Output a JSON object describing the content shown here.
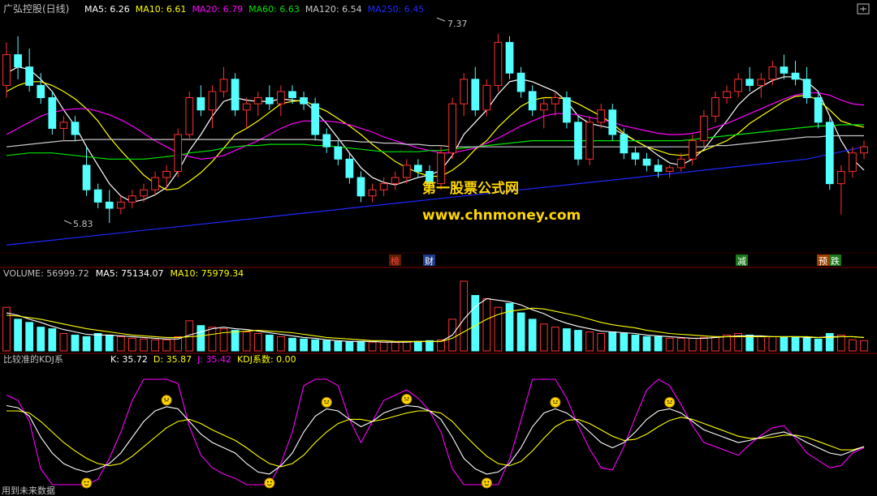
{
  "colors": {
    "up": "#ff3232",
    "down": "#54ffff",
    "ma5": "#ffffff",
    "ma10": "#ffff00",
    "ma20": "#ff00ff",
    "ma60": "#00e600",
    "ma120": "#c8c8c8",
    "ma250": "#1e28ff",
    "label": "#c0c0c0",
    "frame": "#800000",
    "watermark": "#ffd700"
  },
  "price_panel": {
    "title": "广弘控股(日线)",
    "legend": [
      {
        "label": "MA5: 6.26",
        "color": "#ffffff"
      },
      {
        "label": "MA10: 6.61",
        "color": "#ffff00"
      },
      {
        "label": "MA20: 6.79",
        "color": "#ff00ff"
      },
      {
        "label": "MA60: 6.63",
        "color": "#00e600"
      },
      {
        "label": "MA120: 6.54",
        "color": "#c8c8c8"
      },
      {
        "label": "MA250: 6.45",
        "color": "#1e28ff"
      }
    ],
    "high_label": "7.37",
    "low_label": "5.83",
    "markers": [
      {
        "text": "榜",
        "color": "#ff4040",
        "bg": "#5a2000"
      },
      {
        "text": "财",
        "color": "#ffffff",
        "bg": "#1e3a8a"
      },
      {
        "text": "减",
        "color": "#ffffff",
        "bg": "#1a7a1a"
      },
      {
        "text": "预",
        "color": "#ffffff",
        "bg": "#a04000"
      },
      {
        "text": "跌",
        "color": "#ffffff",
        "bg": "#1a7a1a"
      }
    ]
  },
  "watermark": {
    "line1": "第一股票公式网",
    "line2": "www.chnmoney.com"
  },
  "volume_panel": {
    "legend": [
      {
        "label": "VOLUME: 56999.72",
        "color": "#c0c0c0"
      },
      {
        "label": "MA5: 75134.07",
        "color": "#ffffff"
      },
      {
        "label": "MA10: 75979.34",
        "color": "#ffff00"
      }
    ]
  },
  "kdj_panel": {
    "title": "比较准的KDJ系",
    "legend": [
      {
        "label": "K: 35.72",
        "color": "#ffffff"
      },
      {
        "label": "D: 35.87",
        "color": "#ffff00"
      },
      {
        "label": "J: 35.42",
        "color": "#ff00ff"
      },
      {
        "label": "KDJ系数: 0.00",
        "color": "#ffff00"
      }
    ]
  },
  "footer_text": "用到未来数据",
  "chart_data": {
    "type": "candlestick",
    "ylim": [
      5.6,
      7.5
    ],
    "ohlc": [
      [
        6.95,
        7.3,
        6.85,
        7.2
      ],
      [
        7.2,
        7.35,
        7.0,
        7.1
      ],
      [
        7.1,
        7.25,
        6.9,
        6.95
      ],
      [
        6.95,
        7.05,
        6.8,
        6.85
      ],
      [
        6.85,
        6.9,
        6.55,
        6.6
      ],
      [
        6.6,
        6.7,
        6.5,
        6.65
      ],
      [
        6.65,
        6.7,
        6.5,
        6.55
      ],
      [
        6.3,
        6.45,
        6.05,
        6.1
      ],
      [
        6.1,
        6.15,
        5.95,
        6.0
      ],
      [
        6.0,
        6.1,
        5.83,
        5.95
      ],
      [
        5.95,
        6.05,
        5.9,
        6.0
      ],
      [
        6.0,
        6.1,
        5.95,
        6.05
      ],
      [
        6.05,
        6.15,
        6.0,
        6.1
      ],
      [
        6.1,
        6.25,
        6.05,
        6.2
      ],
      [
        6.2,
        6.3,
        6.1,
        6.25
      ],
      [
        6.25,
        6.6,
        6.2,
        6.55
      ],
      [
        6.55,
        6.9,
        6.5,
        6.85
      ],
      [
        6.85,
        6.95,
        6.7,
        6.75
      ],
      [
        6.75,
        6.95,
        6.6,
        6.9
      ],
      [
        6.9,
        7.1,
        6.85,
        7.0
      ],
      [
        7.0,
        7.05,
        6.7,
        6.75
      ],
      [
        6.75,
        6.85,
        6.6,
        6.8
      ],
      [
        6.8,
        6.9,
        6.7,
        6.85
      ],
      [
        6.85,
        6.95,
        6.75,
        6.8
      ],
      [
        6.8,
        6.95,
        6.7,
        6.9
      ],
      [
        6.9,
        6.95,
        6.8,
        6.85
      ],
      [
        6.85,
        6.9,
        6.75,
        6.8
      ],
      [
        6.8,
        6.85,
        6.5,
        6.55
      ],
      [
        6.55,
        6.6,
        6.4,
        6.45
      ],
      [
        6.45,
        6.5,
        6.3,
        6.35
      ],
      [
        6.35,
        6.4,
        6.15,
        6.2
      ],
      [
        6.2,
        6.25,
        6.0,
        6.05
      ],
      [
        6.05,
        6.15,
        6.0,
        6.1
      ],
      [
        6.1,
        6.2,
        6.05,
        6.15
      ],
      [
        6.15,
        6.25,
        6.1,
        6.2
      ],
      [
        6.2,
        6.35,
        6.15,
        6.3
      ],
      [
        6.3,
        6.35,
        6.2,
        6.25
      ],
      [
        6.25,
        6.3,
        6.1,
        6.15
      ],
      [
        6.15,
        6.45,
        6.1,
        6.4
      ],
      [
        6.4,
        6.85,
        6.35,
        6.8
      ],
      [
        6.8,
        7.05,
        6.7,
        7.0
      ],
      [
        7.0,
        7.1,
        6.7,
        6.75
      ],
      [
        6.75,
        7.0,
        6.7,
        6.95
      ],
      [
        6.95,
        7.37,
        6.9,
        7.3
      ],
      [
        7.3,
        7.35,
        7.0,
        7.05
      ],
      [
        7.05,
        7.1,
        6.85,
        6.9
      ],
      [
        6.9,
        6.95,
        6.7,
        6.75
      ],
      [
        6.75,
        6.85,
        6.6,
        6.8
      ],
      [
        6.8,
        6.9,
        6.7,
        6.85
      ],
      [
        6.85,
        6.9,
        6.6,
        6.65
      ],
      [
        6.65,
        6.7,
        6.3,
        6.35
      ],
      [
        6.35,
        6.7,
        6.3,
        6.65
      ],
      [
        6.65,
        6.8,
        6.6,
        6.75
      ],
      [
        6.75,
        6.8,
        6.5,
        6.55
      ],
      [
        6.55,
        6.6,
        6.35,
        6.4
      ],
      [
        6.4,
        6.45,
        6.3,
        6.35
      ],
      [
        6.35,
        6.4,
        6.25,
        6.3
      ],
      [
        6.3,
        6.35,
        6.2,
        6.25
      ],
      [
        6.25,
        6.3,
        6.2,
        6.28
      ],
      [
        6.28,
        6.4,
        6.25,
        6.35
      ],
      [
        6.35,
        6.55,
        6.3,
        6.5
      ],
      [
        6.5,
        6.75,
        6.45,
        6.7
      ],
      [
        6.7,
        6.9,
        6.65,
        6.85
      ],
      [
        6.85,
        6.95,
        6.8,
        6.9
      ],
      [
        6.9,
        7.05,
        6.85,
        7.0
      ],
      [
        7.0,
        7.1,
        6.9,
        6.95
      ],
      [
        6.95,
        7.05,
        6.85,
        7.0
      ],
      [
        7.0,
        7.15,
        6.95,
        7.1
      ],
      [
        7.1,
        7.2,
        7.0,
        7.05
      ],
      [
        7.05,
        7.15,
        6.95,
        7.0
      ],
      [
        7.0,
        7.1,
        6.8,
        6.85
      ],
      [
        6.85,
        6.9,
        6.6,
        6.65
      ],
      [
        6.65,
        6.7,
        6.1,
        6.15
      ],
      [
        6.15,
        6.3,
        5.9,
        6.25
      ],
      [
        6.25,
        6.45,
        6.2,
        6.4
      ],
      [
        6.4,
        6.5,
        6.35,
        6.45
      ]
    ],
    "ma": {
      "MA5": [
        7.05,
        7.1,
        7.08,
        7.0,
        6.9,
        6.75,
        6.62,
        6.45,
        6.3,
        6.15,
        6.05,
        6.0,
        6.02,
        6.06,
        6.12,
        6.25,
        6.42,
        6.55,
        6.7,
        6.82,
        6.85,
        6.83,
        6.82,
        6.82,
        6.84,
        6.83,
        6.82,
        6.74,
        6.64,
        6.52,
        6.4,
        6.28,
        6.2,
        6.16,
        6.14,
        6.17,
        6.2,
        6.22,
        6.26,
        6.38,
        6.55,
        6.65,
        6.75,
        6.88,
        6.98,
        7.0,
        6.98,
        6.94,
        6.9,
        6.82,
        6.7,
        6.64,
        6.62,
        6.6,
        6.55,
        6.5,
        6.45,
        6.38,
        6.32,
        6.3,
        6.35,
        6.43,
        6.55,
        6.66,
        6.79,
        6.88,
        6.94,
        6.99,
        7.02,
        7.02,
        6.98,
        6.9,
        6.7,
        6.5,
        6.35,
        6.26
      ],
      "MA10": [
        6.9,
        6.95,
        6.98,
        6.98,
        6.95,
        6.9,
        6.84,
        6.76,
        6.66,
        6.53,
        6.42,
        6.32,
        6.22,
        6.15,
        6.1,
        6.11,
        6.17,
        6.24,
        6.33,
        6.44,
        6.55,
        6.6,
        6.66,
        6.73,
        6.8,
        6.82,
        6.83,
        6.78,
        6.74,
        6.68,
        6.62,
        6.55,
        6.47,
        6.4,
        6.33,
        6.28,
        6.24,
        6.21,
        6.21,
        6.26,
        6.33,
        6.43,
        6.5,
        6.61,
        6.7,
        6.78,
        6.83,
        6.85,
        6.85,
        6.84,
        6.8,
        6.75,
        6.7,
        6.64,
        6.56,
        6.5,
        6.45,
        6.42,
        6.39,
        6.38,
        6.39,
        6.42,
        6.46,
        6.5,
        6.56,
        6.64,
        6.7,
        6.76,
        6.82,
        6.86,
        6.87,
        6.83,
        6.75,
        6.66,
        6.63,
        6.61
      ],
      "MA20": [
        6.55,
        6.6,
        6.65,
        6.7,
        6.73,
        6.75,
        6.76,
        6.76,
        6.74,
        6.71,
        6.67,
        6.62,
        6.56,
        6.5,
        6.45,
        6.4,
        6.37,
        6.35,
        6.36,
        6.38,
        6.42,
        6.46,
        6.5,
        6.55,
        6.6,
        6.64,
        6.66,
        6.66,
        6.66,
        6.65,
        6.63,
        6.6,
        6.57,
        6.53,
        6.5,
        6.47,
        6.44,
        6.42,
        6.4,
        6.4,
        6.42,
        6.44,
        6.48,
        6.52,
        6.57,
        6.62,
        6.66,
        6.7,
        6.72,
        6.72,
        6.71,
        6.69,
        6.67,
        6.65,
        6.62,
        6.6,
        6.58,
        6.56,
        6.55,
        6.55,
        6.56,
        6.58,
        6.61,
        6.64,
        6.68,
        6.72,
        6.76,
        6.8,
        6.84,
        6.87,
        6.89,
        6.89,
        6.87,
        6.83,
        6.8,
        6.79
      ],
      "MA60": [
        6.38,
        6.39,
        6.4,
        6.4,
        6.4,
        6.39,
        6.38,
        6.37,
        6.36,
        6.35,
        6.35,
        6.35,
        6.35,
        6.36,
        6.37,
        6.38,
        6.4,
        6.41,
        6.42,
        6.44,
        6.45,
        6.46,
        6.46,
        6.47,
        6.47,
        6.47,
        6.47,
        6.46,
        6.46,
        6.45,
        6.44,
        6.43,
        6.42,
        6.41,
        6.41,
        6.41,
        6.41,
        6.42,
        6.42,
        6.43,
        6.44,
        6.45,
        6.46,
        6.47,
        6.48,
        6.49,
        6.5,
        6.5,
        6.5,
        6.5,
        6.5,
        6.5,
        6.5,
        6.5,
        6.5,
        6.5,
        6.5,
        6.5,
        6.5,
        6.5,
        6.51,
        6.52,
        6.53,
        6.54,
        6.55,
        6.56,
        6.57,
        6.58,
        6.59,
        6.6,
        6.61,
        6.62,
        6.62,
        6.63,
        6.63,
        6.63
      ],
      "MA120": [
        6.45,
        6.46,
        6.47,
        6.48,
        6.49,
        6.5,
        6.5,
        6.51,
        6.51,
        6.51,
        6.51,
        6.51,
        6.51,
        6.51,
        6.51,
        6.51,
        6.51,
        6.51,
        6.51,
        6.51,
        6.51,
        6.51,
        6.51,
        6.51,
        6.51,
        6.51,
        6.51,
        6.51,
        6.5,
        6.5,
        6.5,
        6.49,
        6.49,
        6.48,
        6.48,
        6.47,
        6.47,
        6.46,
        6.46,
        6.45,
        6.45,
        6.45,
        6.45,
        6.45,
        6.45,
        6.45,
        6.45,
        6.45,
        6.45,
        6.45,
        6.45,
        6.45,
        6.45,
        6.45,
        6.45,
        6.45,
        6.45,
        6.45,
        6.45,
        6.45,
        6.45,
        6.45,
        6.46,
        6.46,
        6.47,
        6.48,
        6.49,
        6.5,
        6.51,
        6.52,
        6.53,
        6.53,
        6.54,
        6.54,
        6.54,
        6.54
      ],
      "MA250": [
        5.65,
        5.66,
        5.67,
        5.68,
        5.69,
        5.7,
        5.71,
        5.72,
        5.73,
        5.74,
        5.75,
        5.76,
        5.77,
        5.78,
        5.79,
        5.8,
        5.81,
        5.82,
        5.83,
        5.84,
        5.85,
        5.86,
        5.87,
        5.88,
        5.89,
        5.9,
        5.91,
        5.92,
        5.93,
        5.94,
        5.95,
        5.96,
        5.97,
        5.98,
        5.99,
        6.0,
        6.01,
        6.02,
        6.03,
        6.04,
        6.05,
        6.06,
        6.07,
        6.08,
        6.09,
        6.1,
        6.11,
        6.12,
        6.13,
        6.14,
        6.15,
        6.16,
        6.17,
        6.18,
        6.19,
        6.2,
        6.21,
        6.22,
        6.23,
        6.24,
        6.25,
        6.26,
        6.27,
        6.28,
        6.29,
        6.3,
        6.31,
        6.32,
        6.33,
        6.34,
        6.35,
        6.37,
        6.39,
        6.41,
        6.43,
        6.45
      ]
    },
    "volume": [
      55,
      40,
      36,
      30,
      28,
      22,
      20,
      18,
      22,
      20,
      18,
      16,
      15,
      14,
      14,
      18,
      38,
      32,
      30,
      28,
      26,
      24,
      22,
      20,
      18,
      16,
      15,
      14,
      13,
      12,
      12,
      12,
      11,
      11,
      11,
      12,
      12,
      13,
      14,
      40,
      88,
      70,
      66,
      55,
      60,
      48,
      40,
      34,
      30,
      28,
      26,
      24,
      22,
      24,
      22,
      20,
      18,
      18,
      16,
      16,
      16,
      17,
      18,
      20,
      22,
      20,
      18,
      18,
      17,
      18,
      16,
      15,
      22,
      20,
      14,
      13
    ],
    "volume_ma5": [
      48,
      45,
      40,
      36,
      31,
      27,
      24,
      21,
      20,
      20,
      19,
      18,
      17,
      16,
      15,
      15,
      20,
      24,
      28,
      30,
      28,
      27,
      25,
      23,
      21,
      19,
      17,
      16,
      14,
      13,
      12,
      12,
      12,
      11,
      11,
      11,
      12,
      12,
      12,
      20,
      40,
      56,
      66,
      64,
      62,
      58,
      52,
      47,
      40,
      35,
      31,
      28,
      25,
      24,
      23,
      22,
      20,
      19,
      18,
      17,
      16,
      16,
      17,
      18,
      19,
      19,
      19,
      18,
      18,
      18,
      17,
      17,
      18,
      18,
      18,
      17
    ],
    "volume_ma10": [
      45,
      44,
      42,
      40,
      37,
      34,
      31,
      28,
      26,
      24,
      22,
      20,
      19,
      18,
      17,
      17,
      18,
      19,
      21,
      23,
      24,
      25,
      26,
      25,
      24,
      23,
      21,
      19,
      17,
      16,
      15,
      14,
      13,
      13,
      12,
      12,
      12,
      12,
      12,
      16,
      24,
      32,
      40,
      46,
      50,
      52,
      54,
      53,
      50,
      47,
      44,
      40,
      36,
      33,
      31,
      29,
      26,
      24,
      22,
      21,
      20,
      19,
      18,
      18,
      18,
      18,
      18,
      18,
      18,
      18,
      18,
      17,
      17,
      18,
      18,
      17
    ],
    "kdj": {
      "K": [
        75,
        73,
        65,
        45,
        30,
        20,
        15,
        12,
        15,
        20,
        30,
        45,
        60,
        70,
        74,
        72,
        60,
        48,
        40,
        35,
        30,
        20,
        12,
        10,
        18,
        30,
        50,
        65,
        72,
        70,
        62,
        55,
        60,
        68,
        72,
        75,
        74,
        70,
        62,
        45,
        25,
        15,
        10,
        12,
        20,
        35,
        55,
        68,
        72,
        68,
        60,
        50,
        40,
        35,
        40,
        50,
        62,
        70,
        72,
        68,
        60,
        52,
        48,
        44,
        40,
        42,
        45,
        48,
        50,
        46,
        40,
        35,
        30,
        28,
        32,
        36
      ],
      "D": [
        70,
        70,
        68,
        60,
        50,
        40,
        32,
        25,
        20,
        18,
        20,
        27,
        36,
        45,
        54,
        60,
        62,
        58,
        52,
        47,
        42,
        35,
        27,
        20,
        17,
        20,
        28,
        40,
        50,
        58,
        62,
        62,
        60,
        62,
        65,
        68,
        70,
        70,
        68,
        60,
        48,
        37,
        27,
        20,
        18,
        22,
        32,
        44,
        55,
        61,
        62,
        58,
        52,
        46,
        42,
        43,
        48,
        55,
        61,
        64,
        62,
        58,
        54,
        50,
        46,
        44,
        44,
        45,
        47,
        47,
        45,
        41,
        37,
        33,
        33,
        36
      ],
      "J": [
        85,
        80,
        60,
        15,
        0,
        0,
        0,
        0,
        5,
        25,
        50,
        80,
        100,
        100,
        100,
        96,
        55,
        28,
        16,
        10,
        6,
        0,
        0,
        0,
        20,
        50,
        94,
        100,
        100,
        94,
        62,
        40,
        60,
        80,
        85,
        90,
        82,
        70,
        50,
        15,
        0,
        0,
        0,
        0,
        24,
        61,
        100,
        100,
        100,
        82,
        56,
        34,
        16,
        14,
        36,
        64,
        90,
        100,
        94,
        76,
        56,
        40,
        36,
        32,
        28,
        38,
        47,
        54,
        56,
        44,
        30,
        23,
        16,
        18,
        30,
        35
      ]
    }
  }
}
